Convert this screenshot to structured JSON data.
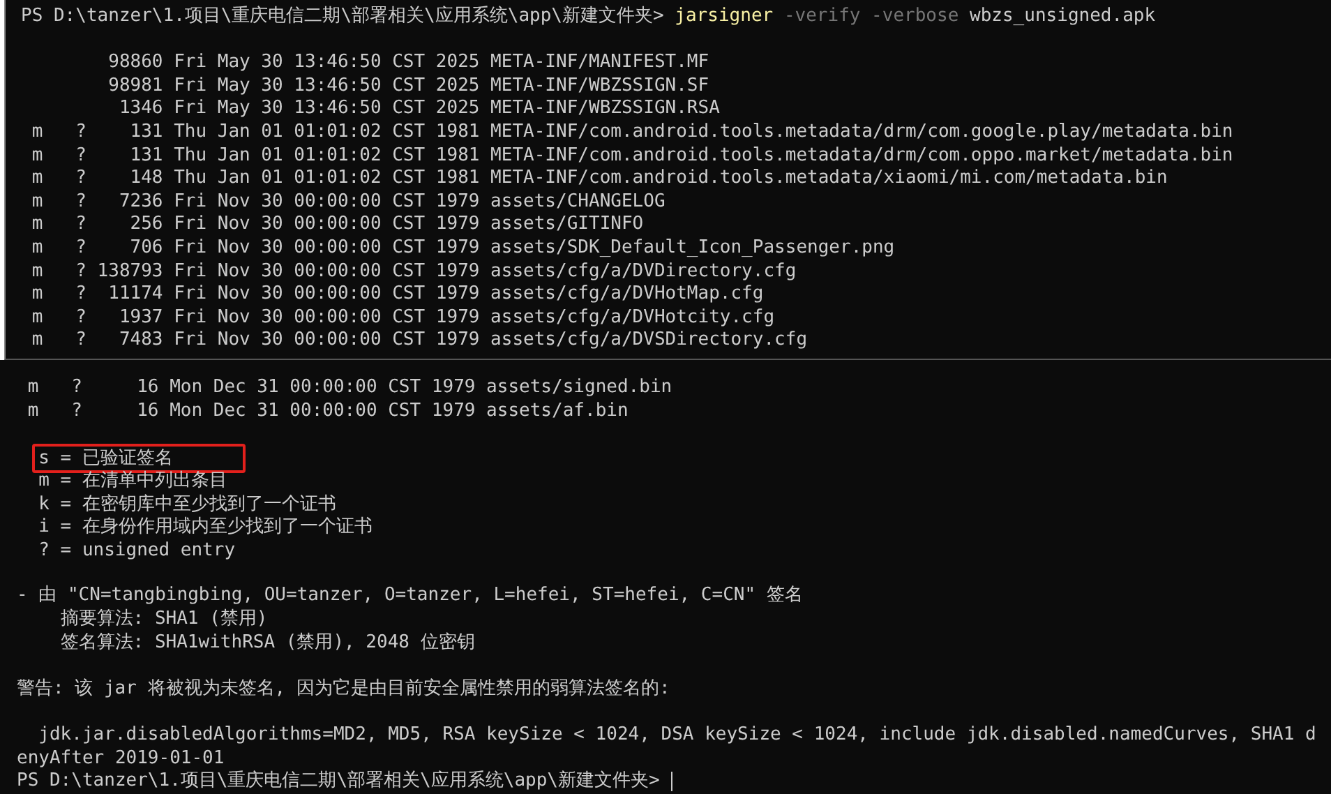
{
  "top_panel": {
    "prompt": {
      "path": "PS D:\\tanzer\\1.项目\\重庆电信二期\\部署相关\\应用系统\\app\\新建文件夹>",
      "command": "jarsigner",
      "options": "-verify -verbose",
      "argument": "wbzs_unsigned.apk"
    },
    "entries": [
      {
        "size": "98860",
        "date": "Fri May 30 13:46:50 CST 2025",
        "path": "META-INF/MANIFEST.MF"
      },
      {
        "size": "98981",
        "date": "Fri May 30 13:46:50 CST 2025",
        "path": "META-INF/WBZSSIGN.SF"
      },
      {
        "size": "1346",
        "date": "Fri May 30 13:46:50 CST 2025",
        "path": "META-INF/WBZSSIGN.RSA"
      },
      {
        "marks": [
          "m",
          "?"
        ],
        "size": "131",
        "date": "Thu Jan 01 01:01:02 CST 1981",
        "path": "META-INF/com.android.tools.metadata/drm/com.google.play/metadata.bin"
      },
      {
        "marks": [
          "m",
          "?"
        ],
        "size": "131",
        "date": "Thu Jan 01 01:01:02 CST 1981",
        "path": "META-INF/com.android.tools.metadata/drm/com.oppo.market/metadata.bin"
      },
      {
        "marks": [
          "m",
          "?"
        ],
        "size": "148",
        "date": "Thu Jan 01 01:01:02 CST 1981",
        "path": "META-INF/com.android.tools.metadata/xiaomi/mi.com/metadata.bin"
      },
      {
        "marks": [
          "m",
          "?"
        ],
        "size": "7236",
        "date": "Fri Nov 30 00:00:00 CST 1979",
        "path": "assets/CHANGELOG"
      },
      {
        "marks": [
          "m",
          "?"
        ],
        "size": "256",
        "date": "Fri Nov 30 00:00:00 CST 1979",
        "path": "assets/GITINFO"
      },
      {
        "marks": [
          "m",
          "?"
        ],
        "size": "706",
        "date": "Fri Nov 30 00:00:00 CST 1979",
        "path": "assets/SDK_Default_Icon_Passenger.png"
      },
      {
        "marks": [
          "m",
          "?"
        ],
        "size": "138793",
        "date": "Fri Nov 30 00:00:00 CST 1979",
        "path": "assets/cfg/a/DVDirectory.cfg"
      },
      {
        "marks": [
          "m",
          "?"
        ],
        "size": "11174",
        "date": "Fri Nov 30 00:00:00 CST 1979",
        "path": "assets/cfg/a/DVHotMap.cfg"
      },
      {
        "marks": [
          "m",
          "?"
        ],
        "size": "1937",
        "date": "Fri Nov 30 00:00:00 CST 1979",
        "path": "assets/cfg/a/DVHotcity.cfg"
      },
      {
        "marks": [
          "m",
          "?"
        ],
        "size": "7483",
        "date": "Fri Nov 30 00:00:00 CST 1979",
        "path": "assets/cfg/a/DVSDirectory.cfg"
      }
    ]
  },
  "bottom_panel": {
    "entries": [
      {
        "marks": [
          "m",
          "?"
        ],
        "size": "16",
        "date": "Mon Dec 31 00:00:00 CST 1979",
        "path": "assets/signed.bin"
      },
      {
        "marks": [
          "m",
          "?"
        ],
        "size": "16",
        "date": "Mon Dec 31 00:00:00 CST 1979",
        "path": "assets/af.bin"
      }
    ],
    "legend": [
      {
        "text": "s = 已验证签名",
        "highlighted": true
      },
      {
        "text": "m = 在清单中列出条目",
        "highlighted": false
      },
      {
        "text": "k = 在密钥库中至少找到了一个证书",
        "highlighted": false
      },
      {
        "text": "i = 在身份作用域内至少找到了一个证书",
        "highlighted": false
      },
      {
        "text": "? = unsigned entry",
        "highlighted": false
      }
    ],
    "signer": "- 由 \"CN=tangbingbing, OU=tanzer, O=tanzer, L=hefei, ST=hefei, C=CN\" 签名",
    "signer_details": [
      "摘要算法: SHA1 (禁用)",
      "签名算法: SHA1withRSA (禁用), 2048 位密钥"
    ],
    "warning": "警告: 该 jar 将被视为未签名, 因为它是由目前安全属性禁用的弱算法签名的:",
    "property": "jdk.jar.disabledAlgorithms=MD2, MD5, RSA keySize < 1024, DSA keySize < 1024, include jdk.disabled.namedCurves, SHA1 denyAfter 2019-01-01",
    "prompt": "PS D:\\tanzer\\1.项目\\重庆电信二期\\部署相关\\应用系统\\app\\新建文件夹>"
  }
}
